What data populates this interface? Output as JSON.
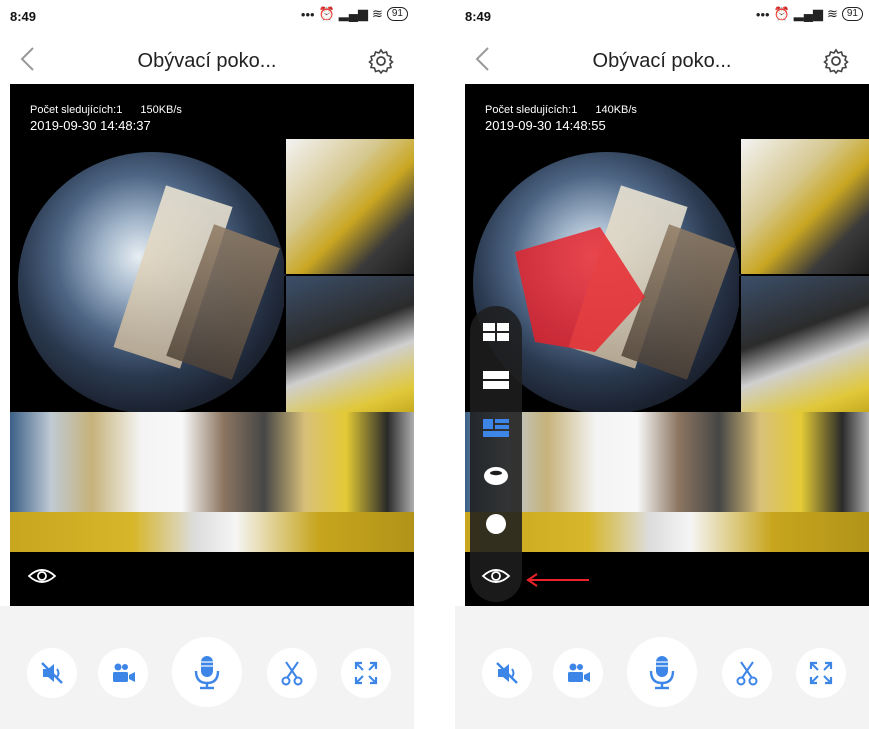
{
  "screens": [
    {
      "status": {
        "time": "8:49",
        "battery": "91"
      },
      "header": {
        "title": "Obývací poko..."
      },
      "video": {
        "viewers": "Počet sledujících:1",
        "bitrate": "150KB/s",
        "datetime": "2019-09-30  14:48:37"
      }
    },
    {
      "status": {
        "time": "8:49",
        "battery": "91"
      },
      "header": {
        "title": "Obývací poko..."
      },
      "video": {
        "viewers": "Počet sledujících:1",
        "bitrate": "140KB/s",
        "datetime": "2019-09-30  14:48:55"
      }
    }
  ],
  "colors": {
    "accent": "#3d86e8",
    "highlight": "#e8212a",
    "panel": "#1e1e1e"
  },
  "icons": {
    "controls": [
      "mute-icon",
      "record-video-icon",
      "microphone-icon",
      "scissors-icon",
      "fullscreen-icon"
    ],
    "view_modes": [
      "quad-view-icon",
      "split-view-icon",
      "panorama-list-view-icon",
      "cylinder-view-icon",
      "fisheye-view-icon",
      "eye-icon"
    ]
  }
}
